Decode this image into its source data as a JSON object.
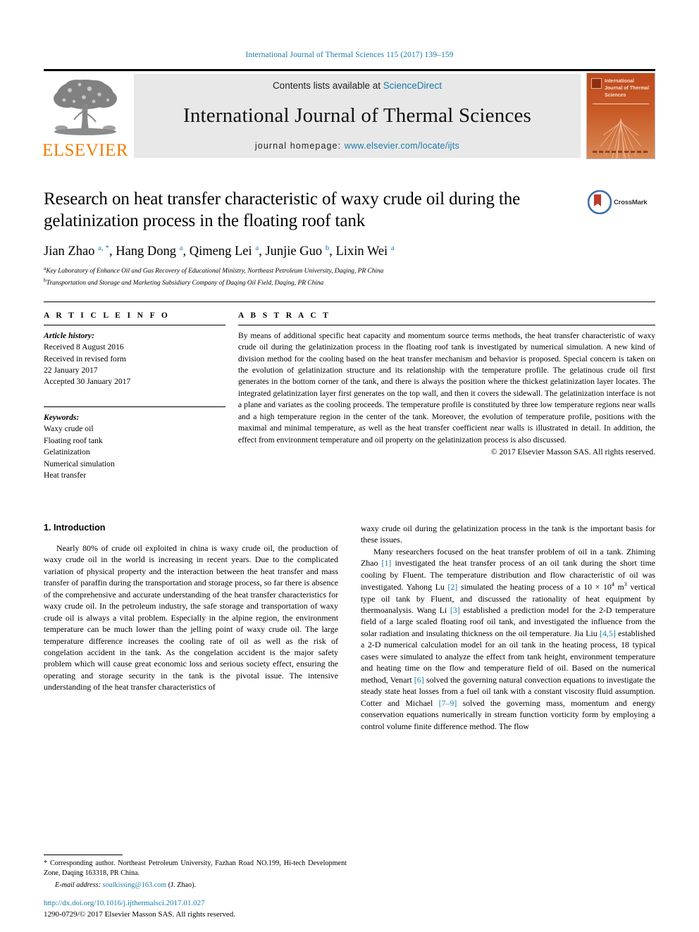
{
  "running_head": "International Journal of Thermal Sciences 115 (2017) 139–159",
  "masthead": {
    "contents_prefix": "Contents lists available at ",
    "sciencedirect": "ScienceDirect",
    "journal_title": "International Journal of Thermal Sciences",
    "homepage_label": "journal homepage:",
    "homepage_url": "www.elsevier.com/locate/ijts",
    "publisher": "ELSEVIER",
    "cover_title": "International Journal of Thermal Sciences",
    "accent_blue": "#1a7ba8",
    "elsevier_orange": "#f07d00",
    "cover_orange": "#c8501f"
  },
  "title_block": {
    "title": "Research on heat transfer characteristic of waxy crude oil during the gelatinization process in the floating roof tank",
    "authors": [
      {
        "name": "Jian Zhao",
        "marks": "a, *"
      },
      {
        "name": "Hang Dong",
        "marks": "a"
      },
      {
        "name": "Qimeng Lei",
        "marks": "a"
      },
      {
        "name": "Junjie Guo",
        "marks": "b"
      },
      {
        "name": "Lixin Wei",
        "marks": "a"
      }
    ],
    "affiliations": [
      {
        "mark": "a",
        "text": "Key Laboratory of Enhance Oil and Gas Recovery of Educational Ministry, Northeast Petroleum University, Daqing, PR China"
      },
      {
        "mark": "b",
        "text": "Transportation and Storage and Marketing Subsidiary Company of Daqing Oil Field, Daqing, PR China"
      }
    ],
    "crossmark_label": "CrossMark"
  },
  "article_info": {
    "heading": "A R T I C L E   I N F O",
    "history_label": "Article history:",
    "history": [
      "Received 8 August 2016",
      "Received in revised form",
      "22 January 2017",
      "Accepted 30 January 2017"
    ],
    "keywords_label": "Keywords:",
    "keywords": [
      "Waxy crude oil",
      "Floating roof tank",
      "Gelatinization",
      "Numerical simulation",
      "Heat transfer"
    ]
  },
  "abstract": {
    "heading": "A B S T R A C T",
    "text": "By means of additional specific heat capacity and momentum source terms methods, the heat transfer characteristic of waxy crude oil during the gelatinization process in the floating roof tank is investigated by numerical simulation. A new kind of division method for the cooling based on the heat transfer mechanism and behavior is proposed. Special concern is taken on the evolution of gelatinization structure and its relationship with the temperature profile. The gelatinous crude oil first generates in the bottom corner of the tank, and there is always the position where the thickest gelatinization layer locates. The integrated gelatinization layer first generates on the top wall, and then it covers the sidewall. The gelatinization interface is not a plane and variates as the cooling proceeds. The temperature profile is constituted by three low temperature regions near walls and a high temperature region in the center of the tank. Moreover, the evolution of temperature profile, positions with the maximal and minimal temperature, as well as the heat transfer coefficient near walls is illustrated in detail. In addition, the effect from environment temperature and oil property on the gelatinization process is also discussed.",
    "copyright": "© 2017 Elsevier Masson SAS. All rights reserved."
  },
  "introduction": {
    "section_number_title": "1. Introduction",
    "left_paragraph": "Nearly 80% of crude oil exploited in china is waxy crude oil, the production of waxy crude oil in the world is increasing in recent years. Due to the complicated variation of physical property and the interaction between the heat transfer and mass transfer of paraffin during the transportation and storage process, so far there is absence of the comprehensive and accurate understanding of the heat transfer characteristics for waxy crude oil. In the petroleum industry, the safe storage and transportation of waxy crude oil is always a vital problem. Especially in the alpine region, the environment temperature can be much lower than the jelling point of waxy crude oil. The large temperature difference increases the cooling rate of oil as well as the risk of congelation accident in the tank. As the congelation accident is the major safety problem which will cause great economic loss and serious society effect, ensuring the operating and storage security in the tank is the pivotal issue. The intensive understanding of the heat transfer characteristics of",
    "right_paragraph_1": "waxy crude oil during the gelatinization process in the tank is the important basis for these issues.",
    "right_paragraph_2_parts": [
      {
        "t": "Many researchers focused on the heat transfer problem of oil in a tank. Zhiming Zhao "
      },
      {
        "ref": "[1]"
      },
      {
        "t": " investigated the heat transfer process of an oil tank during the short time cooling by Fluent. The temperature distribution and flow characteristic of oil was investigated. Yahong Lu "
      },
      {
        "ref": "[2]"
      },
      {
        "t": " simulated the heating process of a 10 × 10"
      },
      {
        "sup": "4"
      },
      {
        "t": " m"
      },
      {
        "sup": "3"
      },
      {
        "t": " vertical type oil tank by Fluent, and discussed the rationality of heat equipment by thermoanalysis. Wang Li "
      },
      {
        "ref": "[3]"
      },
      {
        "t": " established a prediction model for the 2-D temperature field of a large scaled floating roof oil tank, and investigated the influence from the solar radiation and insulating thickness on the oil temperature. Jia Liu "
      },
      {
        "ref": "[4,5]"
      },
      {
        "t": " established a 2-D numerical calculation model for an oil tank in the heating process, 18 typical cases were simulated to analyze the effect from tank height, environment temperature and heating time on the flow and temperature field of oil. Based on the numerical method, Venart "
      },
      {
        "ref": "[6]"
      },
      {
        "t": " solved the governing natural convection equations to investigate the steady state heat losses from a fuel oil tank with a constant viscosity fluid assumption. Cotter and Michael "
      },
      {
        "ref": "[7–9]"
      },
      {
        "t": " solved the governing mass, momentum and energy conservation equations numerically in stream function vorticity form by employing a control volume finite difference method. The flow"
      }
    ]
  },
  "footnote": {
    "corresponding": "* Corresponding author. Northeast Petroleum University, Fazhan Road NO.199, Hi-tech Development Zone, Daqing 163318, PR China.",
    "email_label": "E-mail address:",
    "email": "soulkissing@163.com",
    "email_suffix": "(J. Zhao)."
  },
  "doi_block": {
    "doi_url": "http://dx.doi.org/10.1016/j.ijthermalsci.2017.01.027",
    "issn_line": "1290-0729/© 2017 Elsevier Masson SAS. All rights reserved."
  }
}
